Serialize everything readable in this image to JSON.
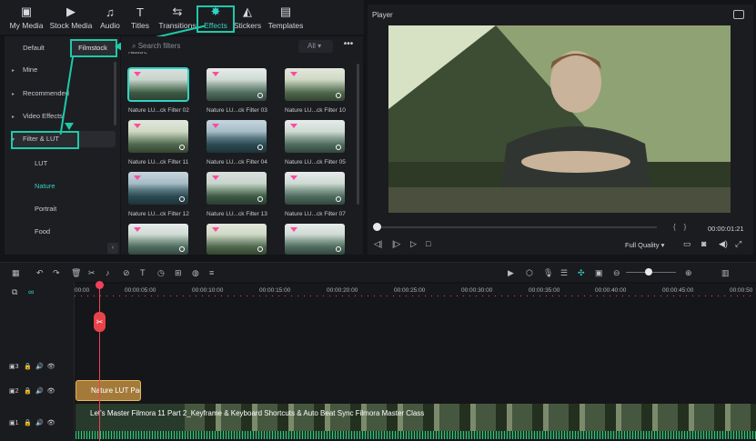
{
  "toolbar": {
    "tabs": [
      {
        "label": "My Media",
        "icon": "media-icon"
      },
      {
        "label": "Stock Media",
        "icon": "stock-icon"
      },
      {
        "label": "Audio",
        "icon": "music-icon"
      },
      {
        "label": "Titles",
        "icon": "titles-icon"
      },
      {
        "label": "Transitions",
        "icon": "transitions-icon"
      },
      {
        "label": "Effects",
        "icon": "effects-icon"
      },
      {
        "label": "Stickers",
        "icon": "stickers-icon"
      },
      {
        "label": "Templates",
        "icon": "templates-icon"
      }
    ],
    "active": "Effects"
  },
  "sidebar": {
    "tab_default": "Default",
    "tab_filmstock": "Filmstock",
    "items": [
      "Mine",
      "Recommended",
      "Video Effects",
      "Filter & LUT"
    ],
    "subitems": [
      "LUT",
      "Nature",
      "Portrait",
      "Food"
    ],
    "selected_subitem": "Nature"
  },
  "content": {
    "search_placeholder": "Search filters",
    "filter_value": "All",
    "section": "Nature",
    "thumbs": [
      "Nature LU...ck Filter 02",
      "Nature LU...ck Filter 03",
      "Nature LU...ck Filter 10",
      "Nature LU...ck Filter 11",
      "Nature LU...ck Filter 04",
      "Nature LU...ck Filter 05",
      "Nature LU...ck Filter 12",
      "Nature LU...ck Filter 13",
      "Nature LU...ck Filter 07"
    ]
  },
  "player": {
    "title": "Player",
    "timecode": "00:00:01:21",
    "quality": "Full Quality"
  },
  "timeline": {
    "ruler": [
      "00:00",
      "00:00:05:00",
      "00:00:10:00",
      "00:00:15:00",
      "00:00:20:00",
      "00:00:25:00",
      "00:00:30:00",
      "00:00:35:00",
      "00:00:40:00",
      "00:00:45:00",
      "00:00:50"
    ],
    "tracks": [
      "3",
      "2",
      "1"
    ],
    "effect_clip": "Nature LUT Pac",
    "video_clip": "Let's Master Filmora 11 Part 2_Keyframe & Keyboard Shortcuts & Auto Beat Sync  Filmora Master Class"
  },
  "colors": {
    "accent": "#33d2c5",
    "highlight": "#1fc9a8",
    "playhead": "#f0415a",
    "clip_effect": "#a47a3b"
  }
}
